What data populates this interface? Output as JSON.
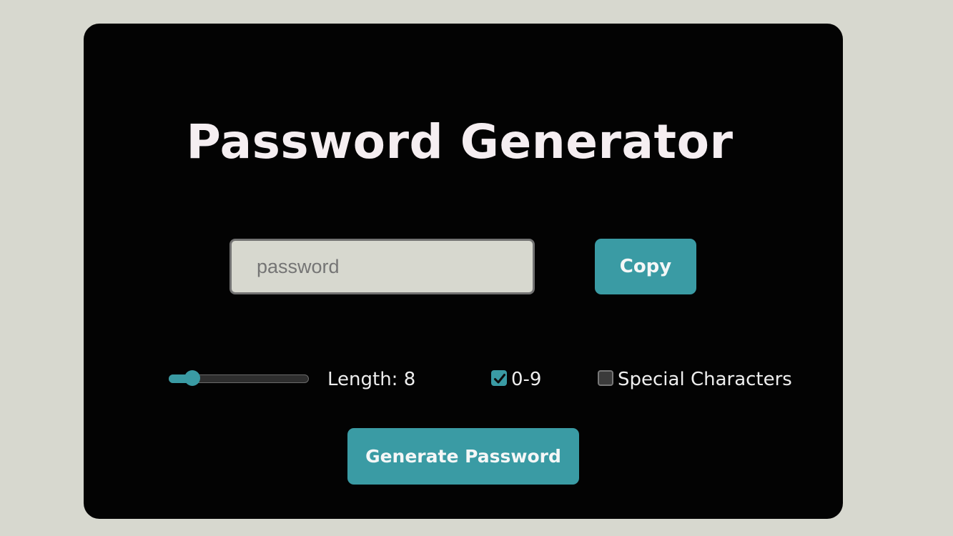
{
  "app": {
    "title": "Password Generator"
  },
  "password_field": {
    "value": "",
    "placeholder": "password"
  },
  "copy_button": {
    "label": "Copy"
  },
  "length_slider": {
    "value": 8,
    "label": "Length: 8"
  },
  "options": {
    "digits": {
      "label": "0-9",
      "checked": true
    },
    "special": {
      "label": "Special Characters",
      "checked": false
    }
  },
  "generate_button": {
    "label": "Generate Password"
  },
  "colors": {
    "background": "#d7d8cf",
    "card": "#030303",
    "accent": "#3a9ba4",
    "title": "#f5eef1",
    "text": "#eeeeee"
  },
  "icons": {
    "checkmark": "check-icon"
  }
}
